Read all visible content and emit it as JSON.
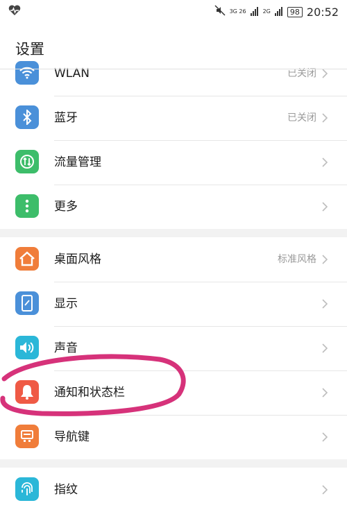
{
  "status_bar": {
    "heart_icon": "heart-rate-icon",
    "network_1": "3G 26",
    "network_2": "2G",
    "battery": "98",
    "time": "20:52"
  },
  "page": {
    "title": "设置"
  },
  "settings": {
    "items": [
      {
        "label": "WLAN",
        "value": "已关闭",
        "icon": "wifi-icon",
        "color": "#4a90d9"
      },
      {
        "label": "蓝牙",
        "value": "已关闭",
        "icon": "bluetooth-icon",
        "color": "#4a90d9"
      },
      {
        "label": "流量管理",
        "value": "",
        "icon": "data-usage-icon",
        "color": "#3dbd6a"
      },
      {
        "label": "更多",
        "value": "",
        "icon": "more-icon",
        "color": "#3dbd6a"
      },
      {
        "label": "桌面风格",
        "value": "标准风格",
        "icon": "home-icon",
        "color": "#f07d3a"
      },
      {
        "label": "显示",
        "value": "",
        "icon": "display-icon",
        "color": "#4a90d9"
      },
      {
        "label": "声音",
        "value": "",
        "icon": "sound-icon",
        "color": "#2bb7d8"
      },
      {
        "label": "通知和状态栏",
        "value": "",
        "icon": "notification-icon",
        "color": "#ef5a45"
      },
      {
        "label": "导航键",
        "value": "",
        "icon": "navigation-key-icon",
        "color": "#f07d3a"
      },
      {
        "label": "指纹",
        "value": "",
        "icon": "fingerprint-icon",
        "color": "#2bb7d8"
      }
    ]
  }
}
